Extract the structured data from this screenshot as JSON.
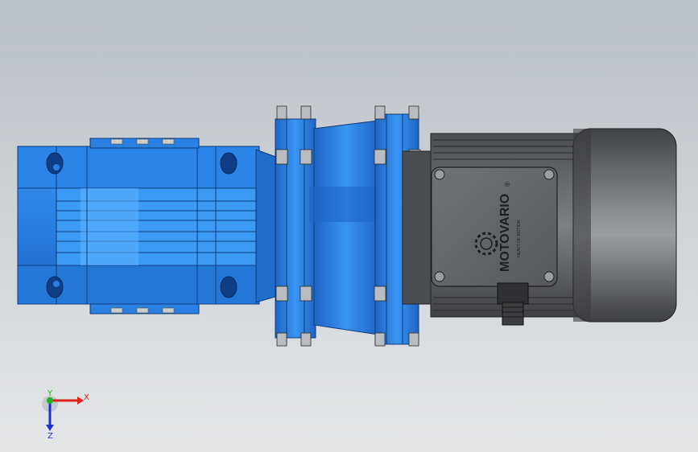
{
  "window": {
    "title": ""
  },
  "model": {
    "brand": "MOTOVARIO",
    "registered_mark": "®",
    "tagline": "HEART OF MOTION",
    "colors": {
      "gearbox_blue": "#2f86e6",
      "gearbox_blue_dark": "#1d5fb8",
      "motor_gray": "#5d6064",
      "motor_dark": "#3a3c3f",
      "background_top": "#b9c0c6",
      "background_bottom": "#e4e6e8"
    }
  },
  "triad": {
    "x_label": "X",
    "y_label": "Y",
    "z_label": "Z",
    "colors": {
      "x": "#e02020",
      "y": "#20b020",
      "z": "#2030d0"
    }
  }
}
